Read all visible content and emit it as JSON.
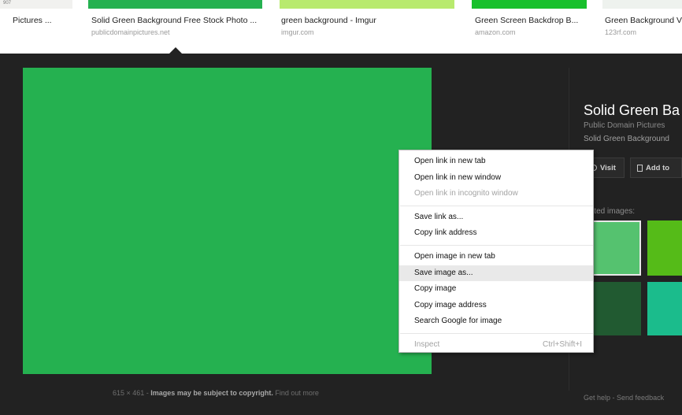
{
  "results": [
    {
      "title": "Pictures ...",
      "site": "",
      "thumb_label": "907"
    },
    {
      "title": "Solid Green Background Free Stock Photo ...",
      "site": "publicdomainpictures.net"
    },
    {
      "title": "green background - Imgur",
      "site": "imgur.com"
    },
    {
      "title": "Green Screen Backdrop B...",
      "site": "amazon.com"
    },
    {
      "title": "Green Background V",
      "site": "123rf.com"
    }
  ],
  "preview": {
    "dimensions": "615 × 461",
    "sep": " - ",
    "copyright": "Images may be subject to copyright.",
    "find_out_more": " Find out more"
  },
  "sidebar": {
    "title": "Solid Green Ba",
    "source": "Public Domain Pictures",
    "description": "Solid Green Background",
    "visit_label": "Visit",
    "add_label": "Add to",
    "related_label": "elated images:",
    "footer_help": "Get help",
    "footer_sep": " - ",
    "footer_feedback": "Send feedback"
  },
  "context_menu": {
    "group1": [
      "Open link in new tab",
      "Open link in new window",
      "Open link in incognito window"
    ],
    "group2": [
      "Save link as...",
      "Copy link address"
    ],
    "group3": [
      "Open image in new tab",
      "Save image as...",
      "Copy image",
      "Copy image address",
      "Search Google for image"
    ],
    "inspect": "Inspect",
    "inspect_shortcut": "Ctrl+Shift+I"
  },
  "colors": {
    "panel_bg": "#222222",
    "image_green": "#25b150",
    "menu_highlight": "#e9e9e9"
  }
}
